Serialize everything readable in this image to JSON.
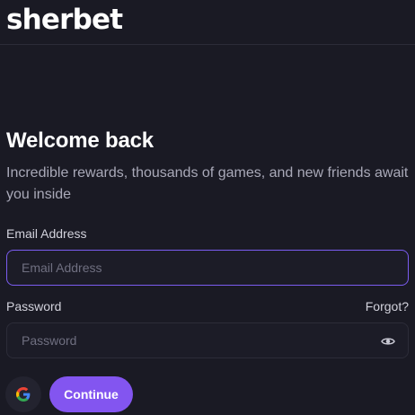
{
  "header": {
    "logo_text": "sherbet"
  },
  "login": {
    "title": "Welcome back",
    "subtitle": "Incredible rewards, thousands of games, and new friends await you inside",
    "email_label": "Email Address",
    "email_placeholder": "Email Address",
    "email_value": "",
    "password_label": "Password",
    "password_placeholder": "Password",
    "password_value": "",
    "forgot_label": "Forgot?",
    "continue_label": "Continue",
    "google_icon": "google-icon",
    "eye_icon": "eye-icon"
  },
  "colors": {
    "background": "#1a1a24",
    "accent": "#8355f0",
    "focus_border": "#7b5cf0"
  }
}
